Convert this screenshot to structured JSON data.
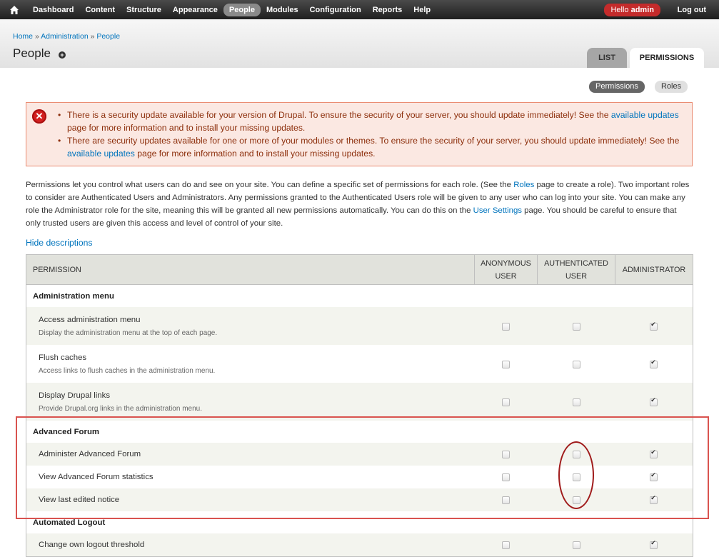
{
  "toolbar": {
    "home_icon": "home-icon",
    "menu": [
      "Dashboard",
      "Content",
      "Structure",
      "Appearance",
      "People",
      "Modules",
      "Configuration",
      "Reports",
      "Help"
    ],
    "active": "People",
    "hello": "Hello",
    "user": "admin",
    "logout": "Log out"
  },
  "breadcrumb": {
    "home": "Home",
    "sep1": "»",
    "admin": "Administration",
    "sep2": "»",
    "people": "People"
  },
  "page": {
    "title": "People",
    "add_icon": "plus-circle-icon"
  },
  "tabs": {
    "list": "LIST",
    "permissions": "PERMISSIONS"
  },
  "subtabs": {
    "permissions": "Permissions",
    "roles": "Roles"
  },
  "messages": {
    "error_icon": "error-x-icon",
    "m1_pre": "There is a security update available for your version of Drupal. To ensure the security of your server, you should update immediately! See the ",
    "m1_link": "available updates",
    "m1_post": " page for more information and to install your missing updates.",
    "m2_pre": "There are security updates available for one or more of your modules or themes. To ensure the security of your server, you should update immediately! See the ",
    "m2_link": "available updates",
    "m2_post": " page for more information and to install your missing updates."
  },
  "description": {
    "p1": "Permissions let you control what users can do and see on your site. You can define a specific set of permissions for each role. (See the ",
    "roles_link": "Roles",
    "p2": " page to create a role). Two important roles to consider are Authenticated Users and Administrators. Any permissions granted to the Authenticated Users role will be given to any user who can log into your site. You can make any role the Administrator role for the site, meaning this will be granted all new permissions automatically. You can do this on the ",
    "settings_link": "User Settings",
    "p3": " page. You should be careful to ensure that only trusted users are given this access and level of control of your site."
  },
  "hide_descriptions": "Hide descriptions",
  "table": {
    "headers": {
      "permission": "PERMISSION",
      "anon_1": "ANONYMOUS",
      "anon_2": "USER",
      "auth_1": "AUTHENTICATED",
      "auth_2": "USER",
      "admin": "ADMINISTRATOR"
    },
    "modules": [
      {
        "name": "Administration menu",
        "rows": [
          {
            "title": "Access administration menu",
            "desc": "Display the administration menu at the top of each page.",
            "anonymous": false,
            "authenticated": false,
            "administrator": true
          },
          {
            "title": "Flush caches",
            "desc": "Access links to flush caches in the administration menu.",
            "anonymous": false,
            "authenticated": false,
            "administrator": true
          },
          {
            "title": "Display Drupal links",
            "desc": "Provide Drupal.org links in the administration menu.",
            "anonymous": false,
            "authenticated": false,
            "administrator": true
          }
        ]
      },
      {
        "name": "Advanced Forum",
        "rows": [
          {
            "title": "Administer Advanced Forum",
            "desc": "",
            "anonymous": false,
            "authenticated": false,
            "administrator": true
          },
          {
            "title": "View Advanced Forum statistics",
            "desc": "",
            "anonymous": false,
            "authenticated": false,
            "administrator": true
          },
          {
            "title": "View last edited notice",
            "desc": "",
            "anonymous": false,
            "authenticated": false,
            "administrator": true
          }
        ]
      },
      {
        "name": "Automated Logout",
        "rows": [
          {
            "title": "Change own logout threshold",
            "desc": "",
            "anonymous": false,
            "authenticated": false,
            "administrator": true
          }
        ]
      }
    ]
  },
  "colors": {
    "link": "#0074bd",
    "error_text": "#8c2e0b",
    "annotation": "#d9534f"
  }
}
